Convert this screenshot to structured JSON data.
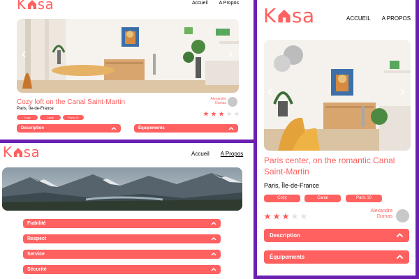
{
  "brand": {
    "logo_text_before": "K",
    "logo_text_after": "sa",
    "color": "#ff6060"
  },
  "frame_color": "#6b1fb1",
  "desktop_listing": {
    "nav": [
      "Accueil",
      "A Propos"
    ],
    "title": "Cozy loft on the Canal Saint-Martin",
    "location": "Paris, Île-de-France",
    "tags": [
      "Cozy",
      "Canal",
      "Paris 10"
    ],
    "host": {
      "first": "Alexandre",
      "last": "Dumas"
    },
    "rating": 3,
    "rating_max": 5,
    "dropdowns": [
      "Description",
      "Équipements"
    ],
    "arrows": {
      "prev": "‹",
      "next": "›"
    }
  },
  "about_page": {
    "nav": [
      "Accueil",
      "A Propos"
    ],
    "dropdowns": [
      "Fiabilité",
      "Respect",
      "Service",
      "Sécurité"
    ]
  },
  "mobile_listing": {
    "nav": [
      "ACCUEIL",
      "A PROPOS"
    ],
    "title": "Paris center, on the romantic Canal Saint-Martin",
    "location": "Paris, Île-de-France",
    "tags": [
      "Cozy",
      "Canal",
      "Paris 10"
    ],
    "host": {
      "first": "Alexandre",
      "last": "Dumas"
    },
    "rating": 3,
    "rating_max": 5,
    "dropdowns": [
      "Description",
      "Équipements"
    ],
    "arrows": {
      "prev": "‹",
      "next": "›"
    }
  }
}
